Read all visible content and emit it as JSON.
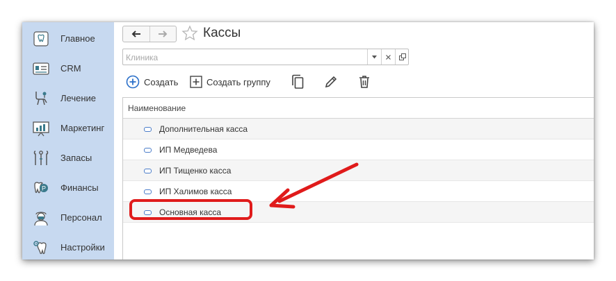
{
  "sidebar": {
    "items": [
      {
        "label": "Главное",
        "icon": "home-tooth-icon"
      },
      {
        "label": "CRM",
        "icon": "crm-card-icon"
      },
      {
        "label": "Лечение",
        "icon": "dental-chair-icon"
      },
      {
        "label": "Маркетинг",
        "icon": "chart-board-icon"
      },
      {
        "label": "Запасы",
        "icon": "dental-tools-icon"
      },
      {
        "label": "Финансы",
        "icon": "tooth-coin-icon"
      },
      {
        "label": "Персонал",
        "icon": "doctor-icon"
      },
      {
        "label": "Настройки",
        "icon": "tooth-gear-icon"
      }
    ]
  },
  "header": {
    "title": "Кассы"
  },
  "filter": {
    "placeholder": "Клиника"
  },
  "toolbar": {
    "create_label": "Создать",
    "create_group_label": "Создать группу"
  },
  "table": {
    "column_header": "Наименование",
    "rows": [
      {
        "label": "Дополнительная касса"
      },
      {
        "label": "ИП Медведева"
      },
      {
        "label": "ИП Тищенко касса"
      },
      {
        "label": "ИП Халимов касса"
      },
      {
        "label": "Основная касса"
      }
    ]
  },
  "annotation": {
    "highlight_color": "#e01b1b"
  },
  "colors": {
    "sidebar_bg": "#c7d9f0",
    "accent_blue": "#2a6fc9"
  }
}
